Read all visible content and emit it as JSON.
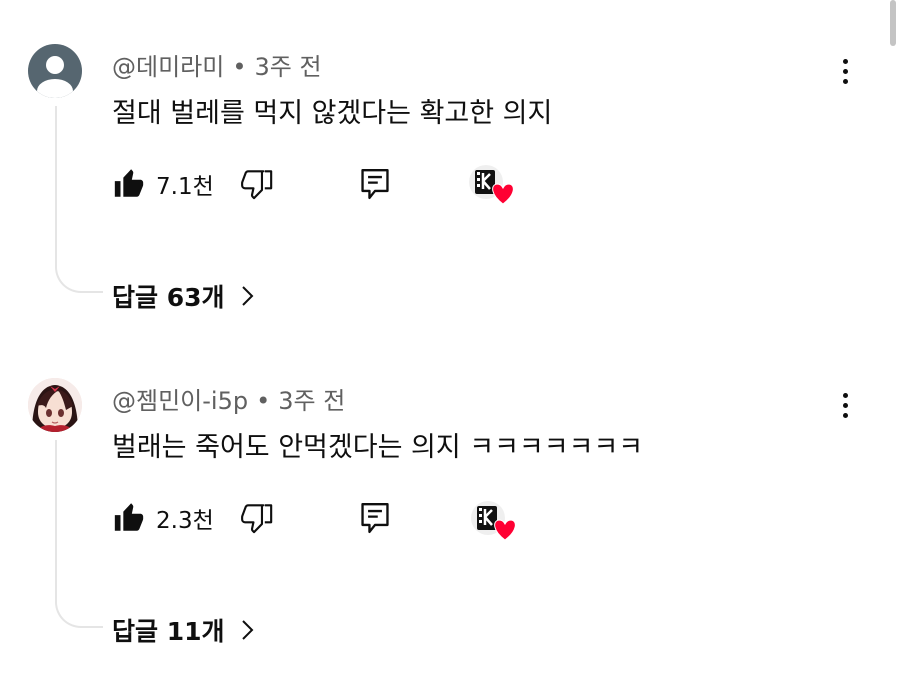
{
  "comments": [
    {
      "author": "@데미라미",
      "separator": "•",
      "time": "3주 전",
      "text": "절대 벌레를 먹지 않겠다는 확고한 의지",
      "likes": "7.1천",
      "replies_label": "답글 63개",
      "avatar": "default-user-avatar"
    },
    {
      "author": "@젬민이-i5p",
      "separator": "•",
      "time": "3주 전",
      "text": "벌래는 죽어도 안먹겠다는 의지 ㅋㅋㅋㅋㅋㅋㅋ",
      "likes": "2.3천",
      "replies_label": "답글 11개",
      "avatar": "anime-character-avatar"
    }
  ],
  "icons": {
    "like": "thumbs-up-filled-icon",
    "dislike": "thumbs-down-outline-icon",
    "reply": "comment-icon",
    "creator_heart": "creator-heart-icon",
    "more": "more-vertical-icon",
    "replies_chevron": "chevron-right-icon"
  },
  "colors": {
    "text": "#0f0f0f",
    "secondary_text": "#606060",
    "heart": "#ff0033",
    "thread_line": "#e5e5e5"
  }
}
